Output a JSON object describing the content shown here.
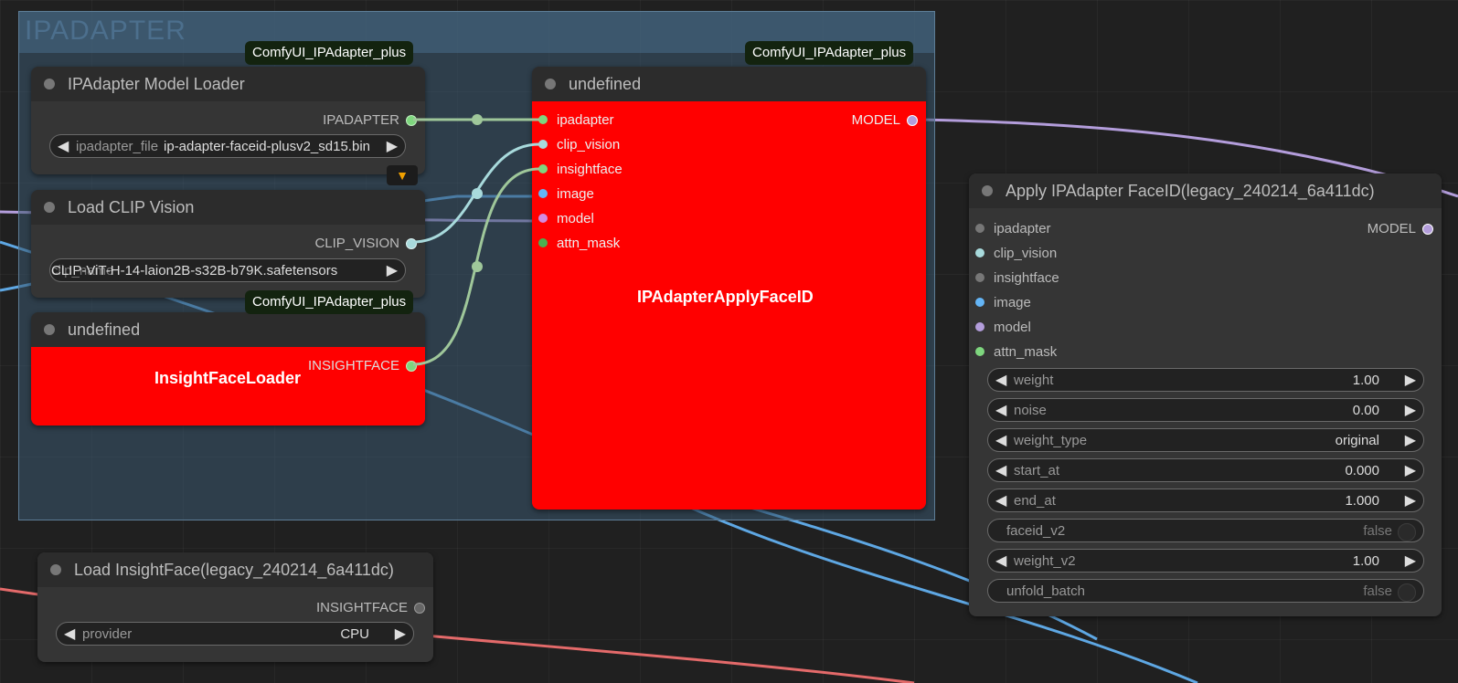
{
  "group": {
    "title": "IPADAPTER"
  },
  "badges": {
    "left": "ComfyUI_IPAdapter_plus",
    "middle": "ComfyUI_IPAdapter_plus",
    "insight": "ComfyUI_IPAdapter_plus"
  },
  "model_loader": {
    "title": "IPAdapter Model Loader",
    "output": "IPADAPTER",
    "widget_label": "ipadapter_file",
    "widget_value": "ip-adapter-faceid-plusv2_sd15.bin",
    "fox_icon": "fox-icon"
  },
  "clip_loader": {
    "title": "Load CLIP Vision",
    "output": "CLIP_VISION",
    "widget_label": "clip_name",
    "widget_value": "CLIP-ViT-H-14-laion2B-s32B-b79K.safetensors"
  },
  "insight_undefined": {
    "title": "undefined",
    "output": "INSIGHTFACE",
    "center_label": "InsightFaceLoader"
  },
  "apply_undefined": {
    "title": "undefined",
    "inputs": [
      "ipadapter",
      "clip_vision",
      "insightface",
      "image",
      "model",
      "attn_mask"
    ],
    "output": "MODEL",
    "center_label": "IPAdapterApplyFaceID"
  },
  "apply_faceid": {
    "title": "Apply IPAdapter FaceID(legacy_240214_6a411dc)",
    "inputs": [
      "ipadapter",
      "clip_vision",
      "insightface",
      "image",
      "model",
      "attn_mask"
    ],
    "output": "MODEL",
    "widgets": [
      {
        "label": "weight",
        "value": "1.00"
      },
      {
        "label": "noise",
        "value": "0.00"
      },
      {
        "label": "weight_type",
        "value": "original"
      },
      {
        "label": "start_at",
        "value": "0.000"
      },
      {
        "label": "end_at",
        "value": "1.000"
      },
      {
        "label": "faceid_v2",
        "value": "false"
      },
      {
        "label": "weight_v2",
        "value": "1.00"
      },
      {
        "label": "unfold_batch",
        "value": "false"
      }
    ]
  },
  "load_insightface": {
    "title": "Load InsightFace(legacy_240214_6a411dc)",
    "output": "INSIGHTFACE",
    "widget_label": "provider",
    "widget_value": "CPU"
  },
  "colors": {
    "ipadapter": "#9fc79a",
    "clip_vision": "#a8dadc",
    "insightface": "#9fc79a",
    "image": "#64b5f6",
    "model": "#b39ddb",
    "latent": "#ff6e6e",
    "error_red": "#ff0000"
  }
}
